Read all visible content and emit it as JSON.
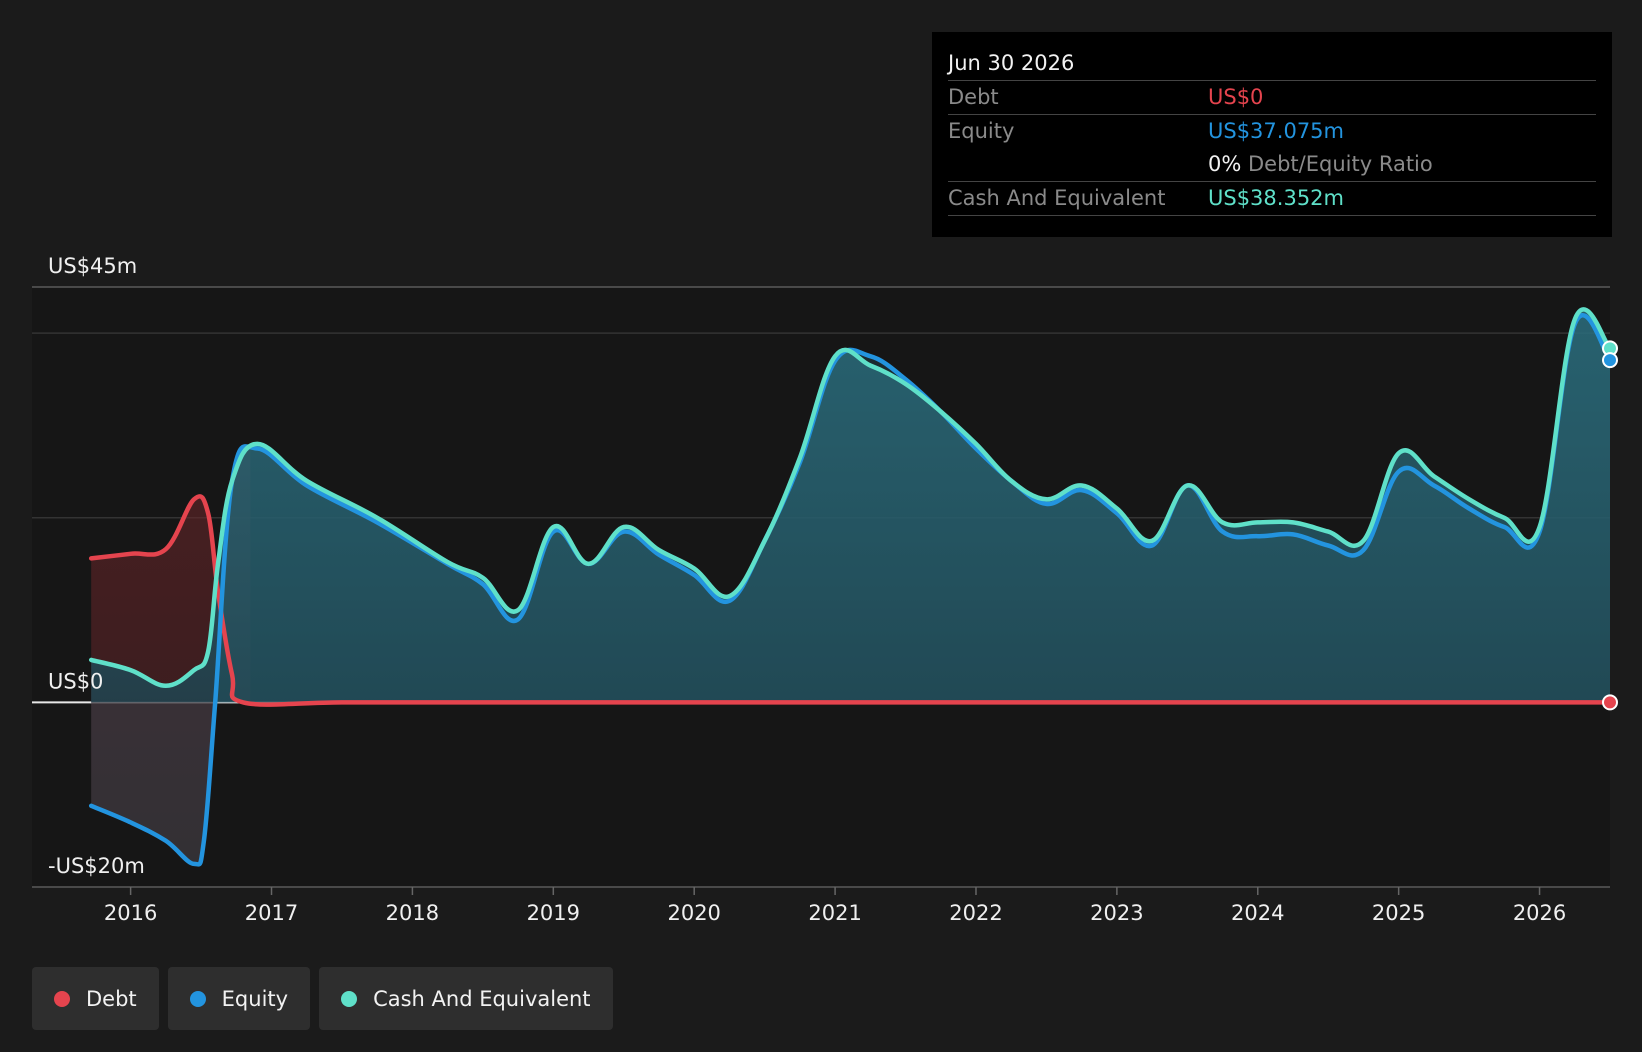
{
  "colors": {
    "debt": "#e5444e",
    "equity": "#2394df",
    "cash": "#5fe0c9",
    "background": "#1b1b1b"
  },
  "tooltip": {
    "date": "Jun 30 2026",
    "debt_label": "Debt",
    "debt_value": "US$0",
    "equity_label": "Equity",
    "equity_value": "US$37.075m",
    "ratio_value": "0%",
    "ratio_label": "Debt/Equity Ratio",
    "cash_label": "Cash And Equivalent",
    "cash_value": "US$38.352m"
  },
  "legend": [
    {
      "label": "Debt",
      "color_key": "debt"
    },
    {
      "label": "Equity",
      "color_key": "equity"
    },
    {
      "label": "Cash And Equivalent",
      "color_key": "cash"
    }
  ],
  "chart_data": {
    "type": "area",
    "title": "",
    "xlabel": "",
    "ylabel": "",
    "ylim": [
      -20,
      45
    ],
    "xlim": [
      2015.3,
      2026.5
    ],
    "y_tick_labels": [
      {
        "value": 45,
        "label": "US$45m"
      },
      {
        "value": 0,
        "label": "US$0"
      },
      {
        "value": -20,
        "label": "-US$20m"
      }
    ],
    "gridlines": [
      45,
      40,
      20,
      0,
      -20
    ],
    "x_ticks": [
      2016,
      2017,
      2018,
      2019,
      2020,
      2021,
      2022,
      2023,
      2024,
      2025,
      2026
    ],
    "x_tick_labels": [
      "2016",
      "2017",
      "2018",
      "2019",
      "2020",
      "2021",
      "2022",
      "2023",
      "2024",
      "2025",
      "2026"
    ],
    "series": [
      {
        "name": "Debt",
        "x": [
          2015.72,
          2016.0,
          2016.25,
          2016.45,
          2016.55,
          2016.62,
          2016.72,
          2016.8,
          2017.5,
          2018.5,
          2019.5,
          2020.5,
          2021.5,
          2022.5,
          2023.5,
          2024.5,
          2025.5,
          2026.0,
          2026.5
        ],
        "values": [
          15.6,
          16.1,
          16.6,
          22.0,
          20.5,
          12.0,
          3.0,
          0.0,
          0.0,
          0.0,
          0.0,
          0.0,
          0.0,
          0.0,
          0.0,
          0.0,
          0.0,
          0.0,
          0.0
        ]
      },
      {
        "name": "Equity",
        "x": [
          2015.72,
          2016.0,
          2016.25,
          2016.45,
          2016.52,
          2016.6,
          2016.72,
          2016.9,
          2017.25,
          2017.75,
          2018.25,
          2018.5,
          2018.75,
          2019.0,
          2019.25,
          2019.5,
          2019.75,
          2020.0,
          2020.25,
          2020.5,
          2020.75,
          2021.0,
          2021.25,
          2021.5,
          2021.75,
          2022.0,
          2022.25,
          2022.5,
          2022.75,
          2023.0,
          2023.25,
          2023.5,
          2023.75,
          2024.0,
          2024.25,
          2024.5,
          2024.75,
          2025.0,
          2025.25,
          2025.5,
          2025.75,
          2026.0,
          2026.25,
          2026.5
        ],
        "values": [
          -11.2,
          -13.0,
          -15.0,
          -17.5,
          -15.0,
          0.0,
          24.0,
          27.5,
          23.5,
          19.5,
          15.0,
          12.8,
          9.0,
          18.5,
          15.0,
          18.5,
          16.0,
          13.8,
          11.0,
          17.5,
          26.0,
          37.0,
          37.5,
          35.0,
          31.5,
          27.5,
          24.0,
          21.5,
          23.0,
          20.5,
          17.0,
          23.5,
          18.5,
          18.0,
          18.2,
          17.0,
          16.5,
          25.0,
          23.5,
          21.0,
          19.0,
          18.5,
          41.0,
          37.075
        ]
      },
      {
        "name": "Cash And Equivalent",
        "x": [
          2015.72,
          2016.0,
          2016.25,
          2016.45,
          2016.55,
          2016.62,
          2016.72,
          2016.9,
          2017.25,
          2017.75,
          2018.25,
          2018.5,
          2018.75,
          2019.0,
          2019.25,
          2019.5,
          2019.75,
          2020.0,
          2020.25,
          2020.5,
          2020.75,
          2021.0,
          2021.25,
          2021.5,
          2021.75,
          2022.0,
          2022.25,
          2022.5,
          2022.75,
          2023.0,
          2023.25,
          2023.5,
          2023.75,
          2024.0,
          2024.25,
          2024.5,
          2024.75,
          2025.0,
          2025.25,
          2025.5,
          2025.75,
          2026.0,
          2026.25,
          2026.5
        ],
        "values": [
          4.6,
          3.5,
          1.8,
          3.5,
          5.5,
          15.0,
          24.0,
          28.0,
          24.0,
          20.0,
          15.2,
          13.5,
          10.0,
          19.0,
          15.0,
          19.0,
          16.5,
          14.5,
          11.5,
          17.5,
          26.5,
          37.5,
          36.5,
          34.5,
          31.5,
          28.0,
          24.0,
          22.0,
          23.5,
          21.0,
          17.5,
          23.5,
          19.5,
          19.5,
          19.5,
          18.5,
          17.5,
          27.0,
          24.5,
          22.0,
          20.0,
          19.0,
          41.5,
          38.352
        ]
      }
    ]
  }
}
